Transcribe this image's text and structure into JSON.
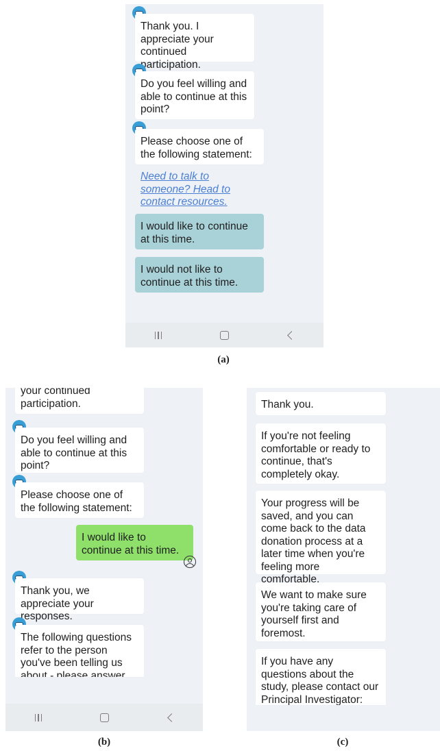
{
  "panel_a": {
    "caption": "(a)",
    "messages": [
      "Thank you. I appreciate your continued participation.",
      "Do you feel willing and able to continue at this point?",
      "Please choose one of the following statement:"
    ],
    "link_text": "Need to talk to someone? Head to contact resources.",
    "choices": [
      "I would like to continue at this time.",
      "I would not like to continue at this time."
    ]
  },
  "panel_b": {
    "caption": "(b)",
    "messages": [
      "your continued participation.",
      "Do you feel willing and able to continue at this point?",
      "Please choose one of the following statement:",
      "Thank you, we appreciate your responses.",
      "The following questions refer to the person you've been telling us about - please answer “yes” to"
    ],
    "user_reply": "I would like to continue at this time."
  },
  "panel_c": {
    "caption": "(c)",
    "messages": [
      "Thank you.",
      "If you're not feeling comfortable or ready to continue, that's completely okay.",
      "Your progress will be saved, and you can come back to the data donation process at a later time when you're feeling more comfortable.",
      "We want to make sure you're taking care of yourself first and foremost.",
      "If you have any questions about the study, please contact our Principal Investigator:"
    ]
  },
  "icons": {
    "bot": "bot-avatar-icon",
    "user": "user-avatar-icon",
    "nav_recent": "recent-apps-icon",
    "nav_home": "home-icon",
    "nav_back": "back-icon"
  }
}
